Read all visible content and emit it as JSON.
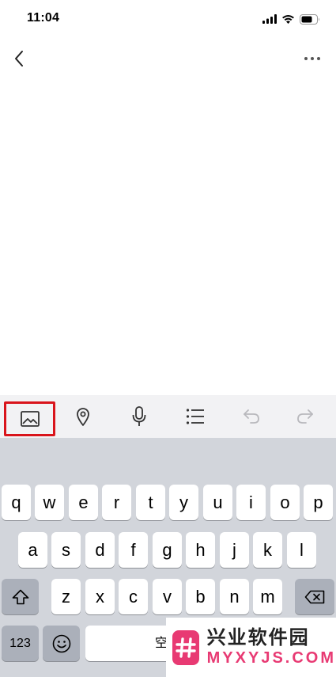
{
  "status_bar": {
    "time": "11:04",
    "icons": [
      "signal-icon",
      "wifi-icon",
      "battery-icon"
    ]
  },
  "nav": {
    "back_icon": "chevron-left-icon",
    "more_icon": "more-horizontal-icon"
  },
  "toolbar": {
    "tools": [
      "image-icon",
      "location-pin-icon",
      "microphone-icon",
      "list-icon",
      "undo-icon",
      "redo-icon"
    ],
    "highlight_color": "#d9141b"
  },
  "keyboard": {
    "row1": [
      "q",
      "w",
      "e",
      "r",
      "t",
      "y",
      "u",
      "i",
      "o",
      "p"
    ],
    "row2": [
      "a",
      "s",
      "d",
      "f",
      "g",
      "h",
      "j",
      "k",
      "l"
    ],
    "row3": [
      "z",
      "x",
      "c",
      "v",
      "b",
      "n",
      "m"
    ],
    "numbers_key": "123",
    "space_key": "空格",
    "shift_icon": "shift-icon",
    "delete_icon": "delete-icon",
    "emoji_icon": "emoji-icon"
  },
  "watermark": {
    "title": "兴业软件园",
    "domain": "MYXYJS.COM"
  }
}
